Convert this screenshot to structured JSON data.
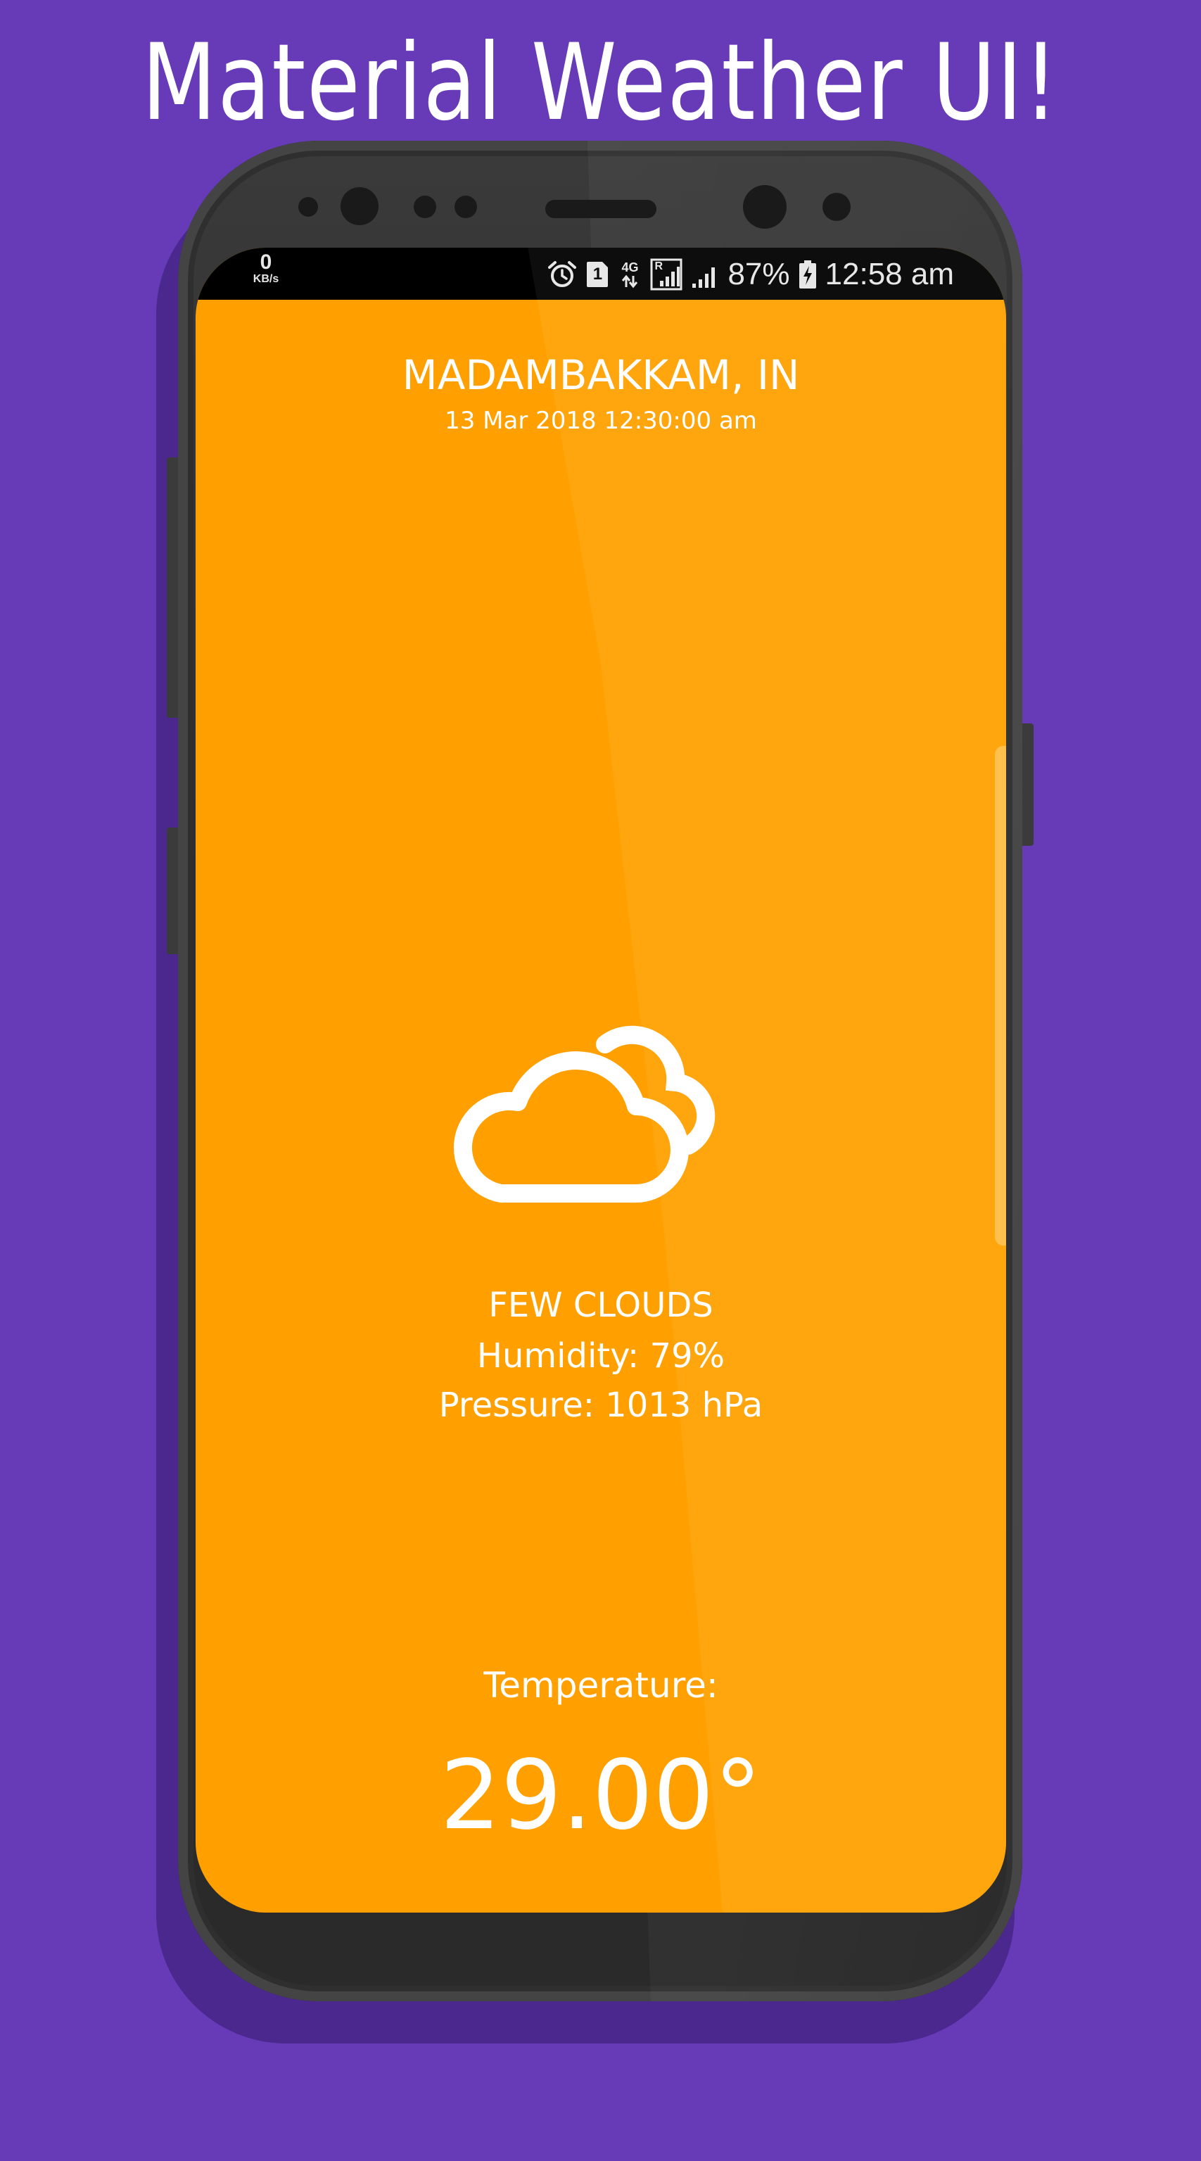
{
  "banner": {
    "title": "Material Weather UI!"
  },
  "status_bar": {
    "net_speed_value": "0",
    "net_speed_unit": "KB/s",
    "sim_slot": "1",
    "network_type": "4G",
    "roaming_indicator": "R",
    "battery": "87%",
    "time": "12:58 am",
    "icons": [
      "alarm-icon",
      "sim-icon",
      "data-4g-icon",
      "roaming-signal-icon",
      "signal-icon",
      "battery-charging-icon"
    ]
  },
  "weather": {
    "location": "MADAMBAKKAM, IN",
    "datetime": "13 Mar 2018 12:30:00 am",
    "icon": "few-clouds-icon",
    "description": "FEW CLOUDS",
    "humidity": "Humidity: 79%",
    "pressure": "Pressure: 1013 hPa",
    "temperature_label": "Temperature:",
    "temperature_value": "29.00°"
  },
  "colors": {
    "background": "#673ab7",
    "screen": "#ffa000",
    "phone_body": "#2e2e2e",
    "text": "#ffffff"
  }
}
